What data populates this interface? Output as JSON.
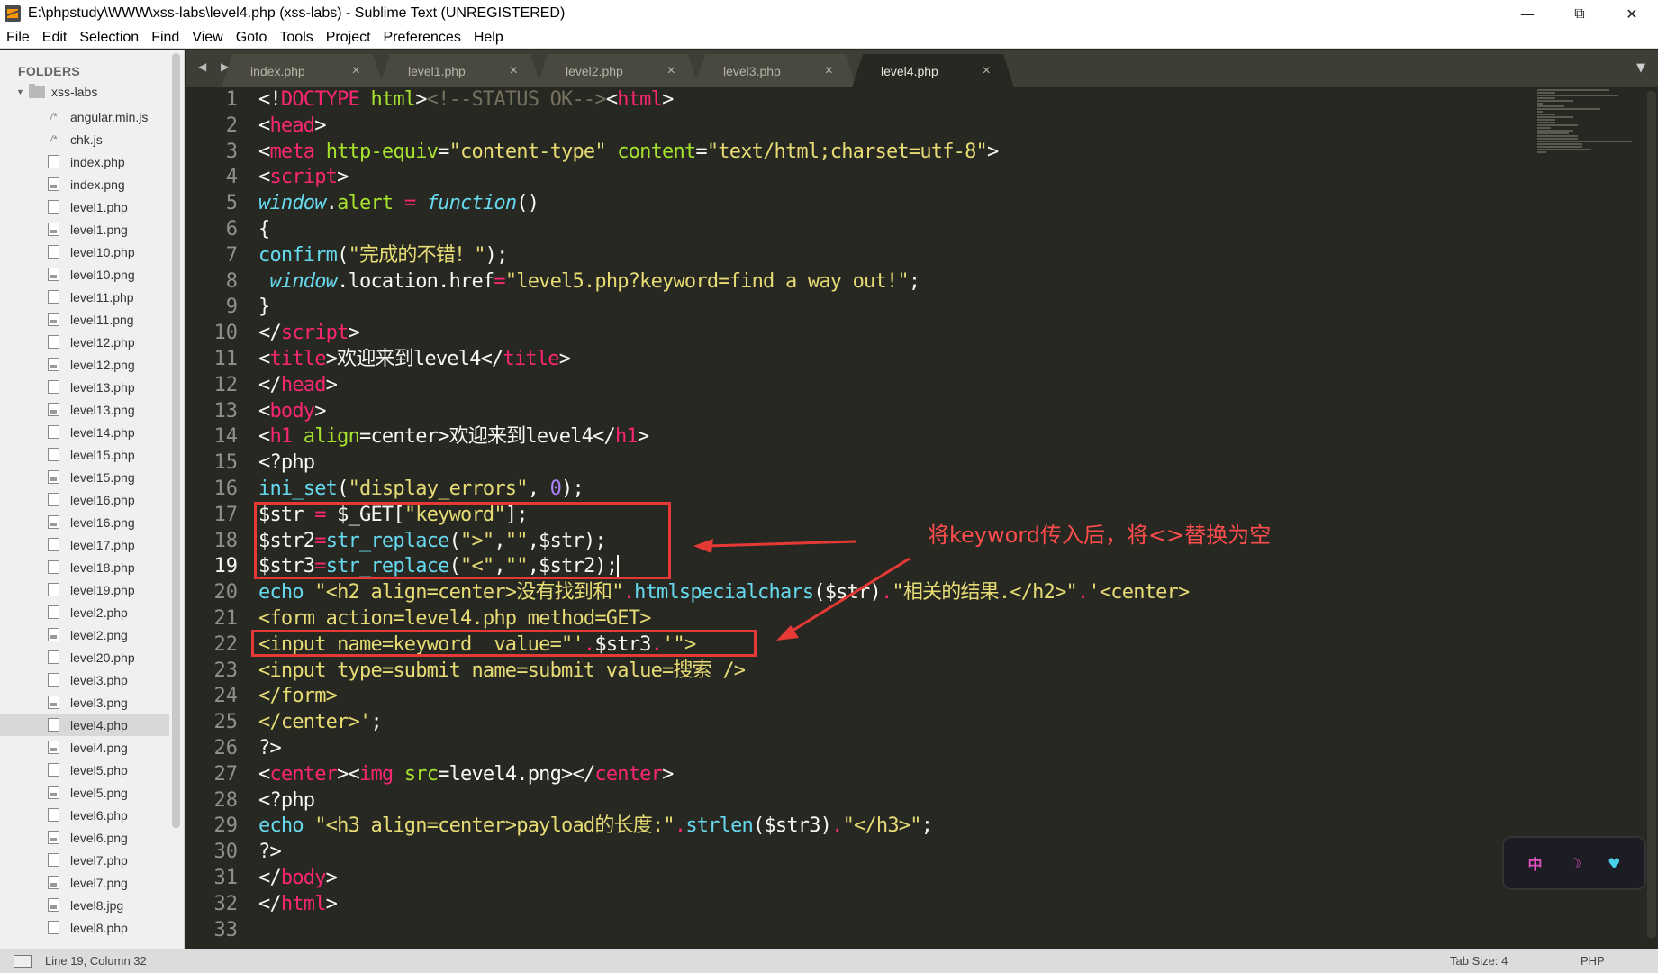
{
  "window": {
    "title": "E:\\phpstudy\\WWW\\xss-labs\\level4.php (xss-labs) - Sublime Text (UNREGISTERED)",
    "minimize": "—",
    "maximize": "⧉",
    "close": "✕"
  },
  "menu": [
    "File",
    "Edit",
    "Selection",
    "Find",
    "View",
    "Goto",
    "Tools",
    "Project",
    "Preferences",
    "Help"
  ],
  "sidebar": {
    "header": "FOLDERS",
    "root": "xss-labs",
    "files": [
      {
        "name": "angular.min.js",
        "type": "js"
      },
      {
        "name": "chk.js",
        "type": "js"
      },
      {
        "name": "index.php",
        "type": "file"
      },
      {
        "name": "index.png",
        "type": "img"
      },
      {
        "name": "level1.php",
        "type": "file"
      },
      {
        "name": "level1.png",
        "type": "img"
      },
      {
        "name": "level10.php",
        "type": "file"
      },
      {
        "name": "level10.png",
        "type": "img"
      },
      {
        "name": "level11.php",
        "type": "file"
      },
      {
        "name": "level11.png",
        "type": "img"
      },
      {
        "name": "level12.php",
        "type": "file"
      },
      {
        "name": "level12.png",
        "type": "img"
      },
      {
        "name": "level13.php",
        "type": "file"
      },
      {
        "name": "level13.png",
        "type": "img"
      },
      {
        "name": "level14.php",
        "type": "file"
      },
      {
        "name": "level15.php",
        "type": "file"
      },
      {
        "name": "level15.png",
        "type": "img"
      },
      {
        "name": "level16.php",
        "type": "file"
      },
      {
        "name": "level16.png",
        "type": "img"
      },
      {
        "name": "level17.php",
        "type": "file"
      },
      {
        "name": "level18.php",
        "type": "file"
      },
      {
        "name": "level19.php",
        "type": "file"
      },
      {
        "name": "level2.php",
        "type": "file"
      },
      {
        "name": "level2.png",
        "type": "img"
      },
      {
        "name": "level20.php",
        "type": "file"
      },
      {
        "name": "level3.php",
        "type": "file"
      },
      {
        "name": "level3.png",
        "type": "img"
      },
      {
        "name": "level4.php",
        "type": "file",
        "selected": true
      },
      {
        "name": "level4.png",
        "type": "img"
      },
      {
        "name": "level5.php",
        "type": "file"
      },
      {
        "name": "level5.png",
        "type": "img"
      },
      {
        "name": "level6.php",
        "type": "file"
      },
      {
        "name": "level6.png",
        "type": "img"
      },
      {
        "name": "level7.php",
        "type": "file"
      },
      {
        "name": "level7.png",
        "type": "img"
      },
      {
        "name": "level8.jpg",
        "type": "img"
      },
      {
        "name": "level8.php",
        "type": "file"
      }
    ]
  },
  "tabs": [
    {
      "label": "index.php",
      "active": false
    },
    {
      "label": "level1.php",
      "active": false
    },
    {
      "label": "level2.php",
      "active": false
    },
    {
      "label": "level3.php",
      "active": false
    },
    {
      "label": "level4.php",
      "active": true
    }
  ],
  "tab_close": "×",
  "tab_nav": "◀ ▶",
  "tab_dropdown": "▼",
  "editor": {
    "current_line": 19,
    "line_numbers": [
      "1",
      "2",
      "3",
      "4",
      "5",
      "6",
      "7",
      "8",
      "9",
      "10",
      "11",
      "12",
      "13",
      "14",
      "15",
      "16",
      "17",
      "18",
      "19",
      "20",
      "21",
      "22",
      "23",
      "24",
      "25",
      "26",
      "27",
      "28",
      "29",
      "30",
      "31",
      "32",
      "33"
    ]
  },
  "annotation": {
    "text": "将keyword传入后，将<>替换为空",
    "color": "#ff4d4d"
  },
  "status": {
    "position": "Line 19, Column 32",
    "tab_size": "Tab Size: 4",
    "syntax": "PHP"
  },
  "ime": {
    "lang": "中",
    "moon": "☽",
    "shirt": "♥"
  }
}
